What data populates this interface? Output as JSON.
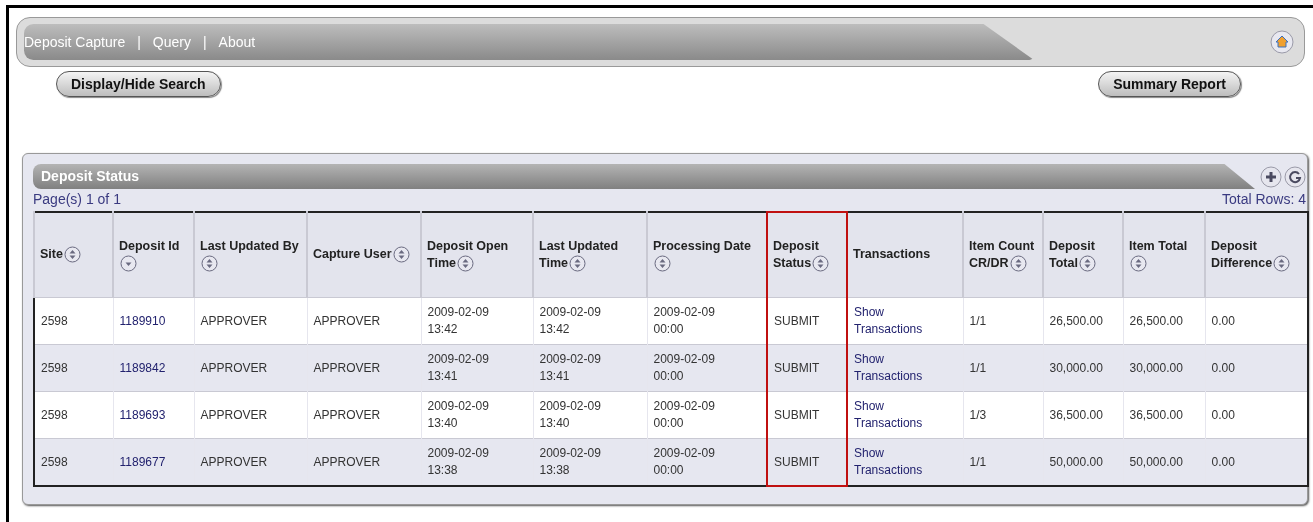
{
  "nav": {
    "links": [
      "Deposit Capture",
      "Query",
      "About"
    ],
    "separator": "|"
  },
  "buttons": {
    "left": "Display/Hide Search",
    "right": "Summary Report"
  },
  "panel": {
    "title": "Deposit Status",
    "pages": "Page(s) 1 of 1",
    "total_rows": "Total Rows: 4"
  },
  "table": {
    "columns": [
      {
        "label": "Site",
        "kind": "sortable",
        "highlighted": false
      },
      {
        "label": "Deposit Id",
        "kind": "sorted",
        "highlighted": false
      },
      {
        "label": "Last Updated By",
        "kind": "sortable",
        "highlighted": false
      },
      {
        "label": "Capture User",
        "kind": "sortable",
        "highlighted": false
      },
      {
        "label": "Deposit Open Time",
        "kind": "sortable",
        "highlighted": false
      },
      {
        "label": "Last Updated Time",
        "kind": "sortable",
        "highlighted": false
      },
      {
        "label": "Processing Date",
        "kind": "sortable",
        "highlighted": false
      },
      {
        "label": "Deposit Status",
        "kind": "sortable",
        "highlighted": true
      },
      {
        "label": "Transactions",
        "kind": "plain",
        "highlighted": false
      },
      {
        "label": "Item Count CR/DR",
        "kind": "sortable",
        "highlighted": false
      },
      {
        "label": "Deposit Total",
        "kind": "sortable",
        "highlighted": false
      },
      {
        "label": "Item Total",
        "kind": "sortable",
        "highlighted": false
      },
      {
        "label": "Deposit Difference",
        "kind": "sortable",
        "highlighted": false
      }
    ],
    "rows": [
      [
        "2598",
        "1189910",
        "APPROVER",
        "APPROVER",
        "2009-02-09 13:42",
        "2009-02-09 13:42",
        "2009-02-09 00:00",
        "SUBMIT",
        "Show Transactions",
        "1/1",
        "26,500.00",
        "26,500.00",
        "0.00"
      ],
      [
        "2598",
        "1189842",
        "APPROVER",
        "APPROVER",
        "2009-02-09 13:41",
        "2009-02-09 13:41",
        "2009-02-09 00:00",
        "SUBMIT",
        "Show Transactions",
        "1/1",
        "30,000.00",
        "30,000.00",
        "0.00"
      ],
      [
        "2598",
        "1189693",
        "APPROVER",
        "APPROVER",
        "2009-02-09 13:40",
        "2009-02-09 13:40",
        "2009-02-09 00:00",
        "SUBMIT",
        "Show Transactions",
        "1/3",
        "36,500.00",
        "36,500.00",
        "0.00"
      ],
      [
        "2598",
        "1189677",
        "APPROVER",
        "APPROVER",
        "2009-02-09 13:38",
        "2009-02-09 13:38",
        "2009-02-09 00:00",
        "SUBMIT",
        "Show Transactions",
        "1/1",
        "50,000.00",
        "50,000.00",
        "0.00"
      ]
    ]
  }
}
